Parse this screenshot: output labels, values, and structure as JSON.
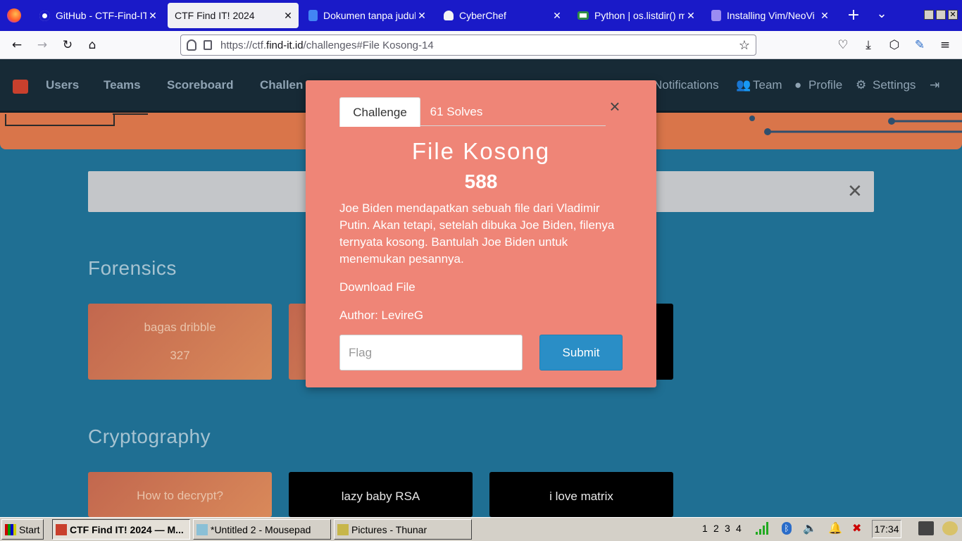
{
  "browser": {
    "tabs": [
      {
        "title": "GitHub - CTF-Find-IT",
        "icon": "github-icon",
        "active": false
      },
      {
        "title": "CTF Find IT! 2024",
        "icon": "",
        "active": true
      },
      {
        "title": "Dokumen tanpa judul",
        "icon": "google-docs-icon",
        "active": false
      },
      {
        "title": "CyberChef",
        "icon": "cyberchef-icon",
        "active": false
      },
      {
        "title": "Python | os.listdir() m",
        "icon": "geeksforgeeks-icon",
        "active": false
      },
      {
        "title": "Installing Vim/NeoVi",
        "icon": "neovim-icon",
        "active": false
      }
    ],
    "new_tab": "+",
    "tab_list": "⌄",
    "url_prefix": "https://ctf.",
    "url_domain": "find-it.id",
    "url_path": "/challenges#File Kosong-14"
  },
  "ctf_nav": {
    "items": [
      "Users",
      "Teams",
      "Scoreboard",
      "Challen"
    ],
    "right_items": [
      "Notifications",
      "Team",
      "Profile",
      "Settings"
    ]
  },
  "categories": [
    {
      "name": "Forensics",
      "cards": [
        {
          "name": "bagas dribble",
          "value": "327",
          "solved": true
        },
        {
          "name": "",
          "value": "",
          "solved": true
        },
        {
          "name": "",
          "value": "",
          "solved": false
        }
      ]
    },
    {
      "name": "Cryptography",
      "cards": [
        {
          "name": "How to decrypt?",
          "value": "",
          "solved": true
        },
        {
          "name": "lazy baby RSA",
          "value": "",
          "solved": false
        },
        {
          "name": "i love matrix",
          "value": "",
          "solved": false
        }
      ]
    }
  ],
  "modal": {
    "tab_challenge": "Challenge",
    "tab_solves": "61 Solves",
    "close": "×",
    "title": "File Kosong",
    "value": "588",
    "description": "Joe Biden mendapatkan sebuah file dari Vladimir Putin. Akan tetapi, setelah dibuka Joe Biden, filenya ternyata kosong. Bantulah Joe Biden untuk menemukan pesannya.",
    "download": "Download File",
    "author": "Author: LevireG",
    "flag_placeholder": "Flag",
    "submit": "Submit"
  },
  "taskbar": {
    "start": "Start",
    "windows": [
      "CTF Find IT! 2024 — M...",
      "*Untitled 2 - Mousepad",
      "Pictures - Thunar"
    ],
    "workspaces": [
      "1",
      "2",
      "3",
      "4"
    ],
    "clock": "17:34"
  },
  "colors": {
    "page_bg": "#1f6f93",
    "modal_bg": "#ef8577",
    "submit": "#2a8ec6",
    "tabbar": "#1a1ac8"
  }
}
